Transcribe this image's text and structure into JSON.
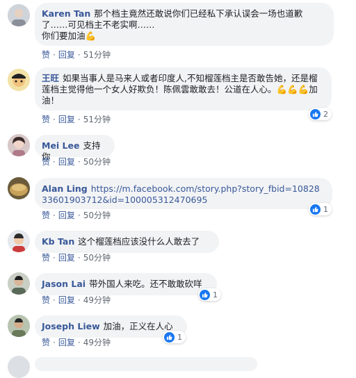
{
  "actions": {
    "like": "赞",
    "reply": "回复",
    "separator": "·"
  },
  "comments": [
    {
      "author": "Karen Tan",
      "text": "那个档主竟然还敢说你们已经私下承认误会一场也道歉了……可见档主不老实啊……\n你们要加油💪",
      "time": "51分钟"
    },
    {
      "author": "王旺",
      "text": "如果当事人是马来人或者印度人,不知榴莲档主是否敢告她，还是榴莲档主觉得他一个女人好欺负！陈佩雲敢敢去！公道在人心。💪💪💪加油！",
      "time": "51分钟",
      "reactions": "2"
    },
    {
      "author": "Mei Lee",
      "text": "支持你",
      "time": "50分钟"
    },
    {
      "author": "Alan Ling",
      "link": "https://m.facebook.com/story.php?story_fbid=1082833601903712&id=100005312470695",
      "time": "50分钟",
      "reactions": "1"
    },
    {
      "author": "Kb Tan",
      "text": "这个榴莲档应该没什么人敢去了",
      "time": "50分钟"
    },
    {
      "author": "Jason Lai",
      "text": "带外国人来吃。还不敢敢砍咩",
      "time": "49分钟",
      "reactions": "1"
    },
    {
      "author": "Joseph Liew",
      "text": "加油，正义在人心",
      "time": "49分钟",
      "reactions": "1"
    }
  ],
  "colors": {
    "author": "#385898",
    "bubble": "#f2f3f5",
    "like": "#1877f2"
  },
  "icons": {
    "reaction": "like-icon",
    "avatar": "profile-avatar"
  }
}
